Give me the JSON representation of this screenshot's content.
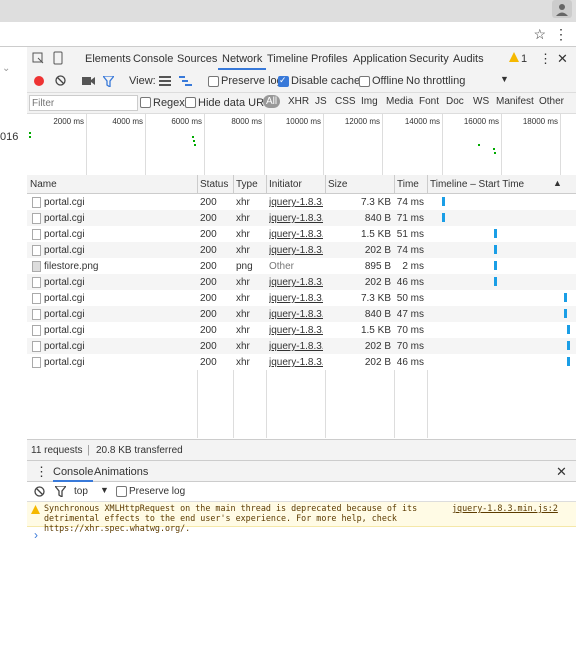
{
  "browser": {
    "profile_icon": "user-icon",
    "close_icon": "close-icon",
    "star_icon": "star-icon",
    "menu_icon": "kebab-icon",
    "left_page_text": "016"
  },
  "devtools": {
    "tabs": [
      "Elements",
      "Console",
      "Sources",
      "Network",
      "Timeline",
      "Profiles",
      "Application",
      "Security",
      "Audits"
    ],
    "active_tab": "Network",
    "warning_count": "1",
    "toolbar": {
      "view_label": "View:",
      "preserve_log": "Preserve log",
      "disable_cache": "Disable cache",
      "offline": "Offline",
      "throttling": "No throttling"
    },
    "filter": {
      "placeholder": "Filter",
      "regex": "Regex",
      "hide_data_urls": "Hide data URLs",
      "types": [
        "All",
        "XHR",
        "JS",
        "CSS",
        "Img",
        "Media",
        "Font",
        "Doc",
        "WS",
        "Manifest",
        "Other"
      ]
    },
    "overview_ticks": [
      "2000 ms",
      "4000 ms",
      "6000 ms",
      "8000 ms",
      "10000 ms",
      "12000 ms",
      "14000 ms",
      "16000 ms",
      "18000 ms"
    ],
    "columns": [
      "Name",
      "Status",
      "Type",
      "Initiator",
      "Size",
      "Time",
      "Timeline – Start Time"
    ],
    "requests": [
      {
        "name": "portal.cgi",
        "status": "200",
        "type": "xhr",
        "initiator": "jquery-1.8.3....",
        "size": "7.3 KB",
        "time": "74 ms",
        "start": 0.08
      },
      {
        "name": "portal.cgi",
        "status": "200",
        "type": "xhr",
        "initiator": "jquery-1.8.3....",
        "size": "840 B",
        "time": "71 ms",
        "start": 0.08
      },
      {
        "name": "portal.cgi",
        "status": "200",
        "type": "xhr",
        "initiator": "jquery-1.8.3....",
        "size": "1.5 KB",
        "time": "51 ms",
        "start": 0.46
      },
      {
        "name": "portal.cgi",
        "status": "200",
        "type": "xhr",
        "initiator": "jquery-1.8.3....",
        "size": "202 B",
        "time": "74 ms",
        "start": 0.46
      },
      {
        "name": "filestore.png",
        "status": "200",
        "type": "png",
        "initiator": "Other",
        "size": "895 B",
        "time": "2 ms",
        "start": 0.46
      },
      {
        "name": "portal.cgi",
        "status": "200",
        "type": "xhr",
        "initiator": "jquery-1.8.3....",
        "size": "202 B",
        "time": "46 ms",
        "start": 0.46
      },
      {
        "name": "portal.cgi",
        "status": "200",
        "type": "xhr",
        "initiator": "jquery-1.8.3....",
        "size": "7.3 KB",
        "time": "50 ms",
        "start": 0.97
      },
      {
        "name": "portal.cgi",
        "status": "200",
        "type": "xhr",
        "initiator": "jquery-1.8.3....",
        "size": "840 B",
        "time": "47 ms",
        "start": 0.97
      },
      {
        "name": "portal.cgi",
        "status": "200",
        "type": "xhr",
        "initiator": "jquery-1.8.3....",
        "size": "1.5 KB",
        "time": "70 ms",
        "start": 0.99
      },
      {
        "name": "portal.cgi",
        "status": "200",
        "type": "xhr",
        "initiator": "jquery-1.8.3....",
        "size": "202 B",
        "time": "70 ms",
        "start": 0.99
      },
      {
        "name": "portal.cgi",
        "status": "200",
        "type": "xhr",
        "initiator": "jquery-1.8.3....",
        "size": "202 B",
        "time": "46 ms",
        "start": 0.99
      }
    ],
    "summary": {
      "requests": "11 requests",
      "transferred": "20.8 KB transferred"
    },
    "drawer": {
      "tabs": [
        "Console",
        "Animations"
      ],
      "context": "top",
      "preserve_log": "Preserve log",
      "warning_text": "Synchronous XMLHttpRequest on the main thread is deprecated because of its detrimental effects to the end user's experience. For more help, check https://xhr.spec.whatwg.org/.",
      "warning_source": "jquery-1.8.3.min.js:2",
      "prompt": "›"
    }
  },
  "colors": {
    "accent": "#3879d9",
    "bar": "#1a9ee6",
    "record": "#e33",
    "warning_bg": "#fffbe5"
  }
}
